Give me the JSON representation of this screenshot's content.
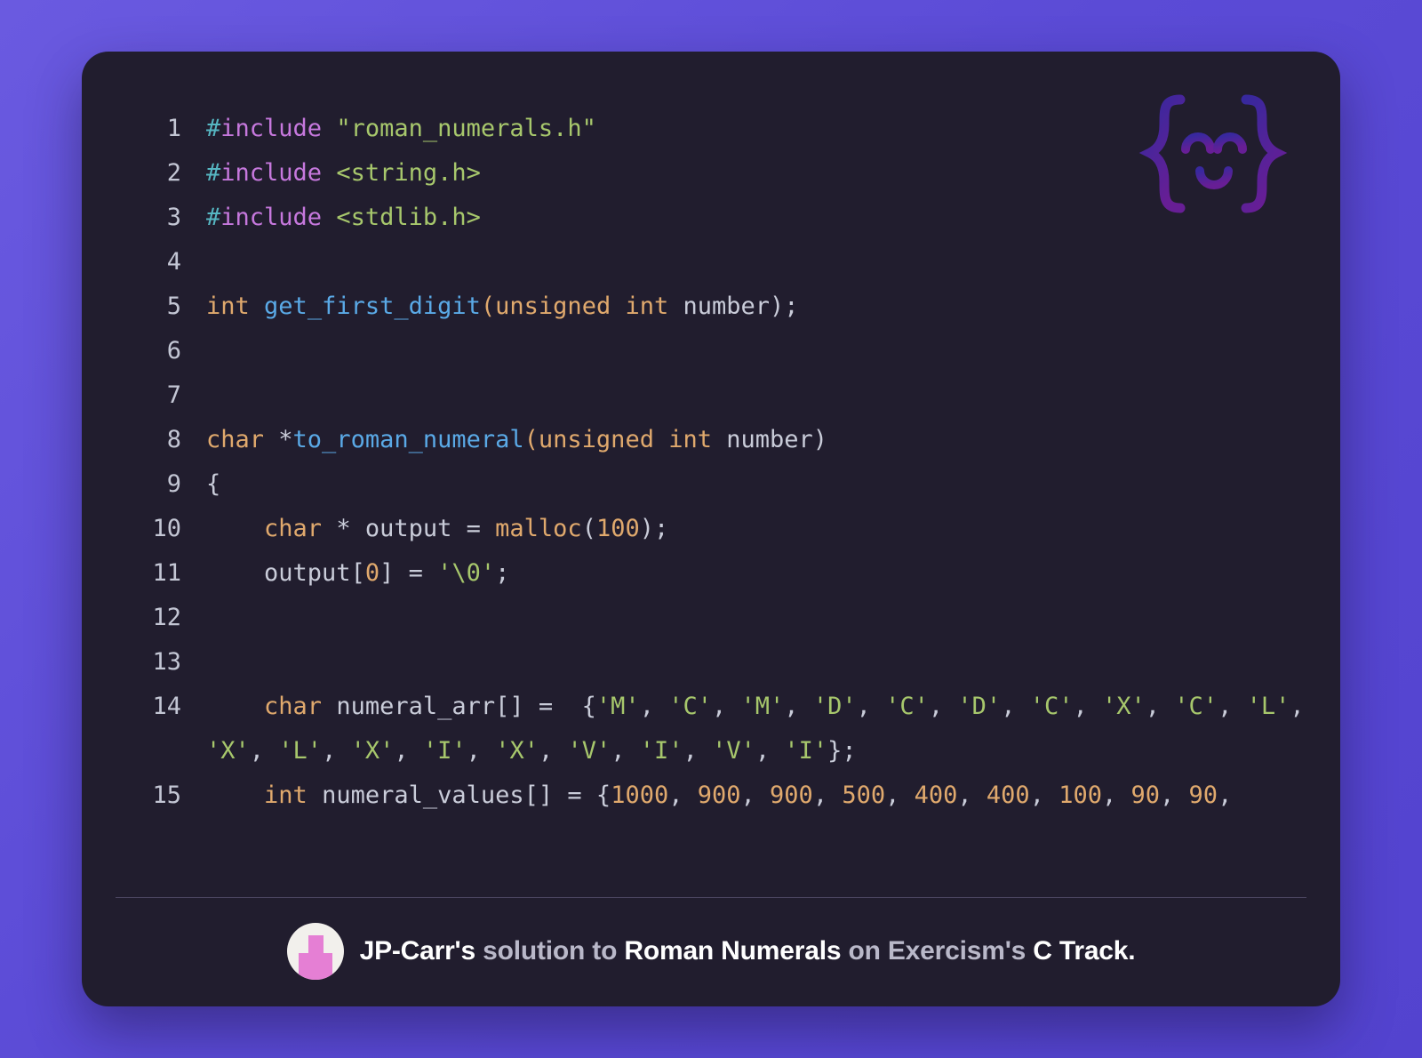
{
  "card": {
    "background_color": "#211d2e",
    "page_background_color": "#5b4bd6"
  },
  "logo": {
    "name": "exercism-logo",
    "colors": [
      "#3b2a9e",
      "#6b1f9e"
    ]
  },
  "editor": {
    "language": "c",
    "line_numbers": [
      "1",
      "2",
      "3",
      "4",
      "5",
      "6",
      "7",
      "8",
      "9",
      "10",
      "11",
      "12",
      "13",
      "14",
      "15"
    ],
    "lines": [
      {
        "number": "1",
        "tokens": [
          {
            "text": "#",
            "type": "pre"
          },
          {
            "text": "include",
            "type": "kw"
          },
          {
            "text": " ",
            "type": "plain"
          },
          {
            "text": "\"roman_numerals.h\"",
            "type": "str"
          }
        ]
      },
      {
        "number": "2",
        "tokens": [
          {
            "text": "#",
            "type": "pre"
          },
          {
            "text": "include",
            "type": "kw"
          },
          {
            "text": " ",
            "type": "plain"
          },
          {
            "text": "<string.h>",
            "type": "str"
          }
        ]
      },
      {
        "number": "3",
        "tokens": [
          {
            "text": "#",
            "type": "pre"
          },
          {
            "text": "include",
            "type": "kw"
          },
          {
            "text": " ",
            "type": "plain"
          },
          {
            "text": "<stdlib.h>",
            "type": "str"
          }
        ]
      },
      {
        "number": "4",
        "tokens": []
      },
      {
        "number": "5",
        "tokens": [
          {
            "text": "int",
            "type": "type"
          },
          {
            "text": " ",
            "type": "plain"
          },
          {
            "text": "get_first_digit",
            "type": "fn"
          },
          {
            "text": "(",
            "type": "type"
          },
          {
            "text": "unsigned",
            "type": "type"
          },
          {
            "text": " ",
            "type": "plain"
          },
          {
            "text": "int",
            "type": "type"
          },
          {
            "text": " number)",
            "type": "plain"
          },
          {
            "text": ";",
            "type": "plain"
          }
        ]
      },
      {
        "number": "6",
        "tokens": []
      },
      {
        "number": "7",
        "tokens": []
      },
      {
        "number": "8",
        "tokens": [
          {
            "text": "char",
            "type": "type"
          },
          {
            "text": " *",
            "type": "plain"
          },
          {
            "text": "to_roman_numeral",
            "type": "fn"
          },
          {
            "text": "(",
            "type": "type"
          },
          {
            "text": "unsigned",
            "type": "type"
          },
          {
            "text": " ",
            "type": "plain"
          },
          {
            "text": "int",
            "type": "type"
          },
          {
            "text": " number)",
            "type": "plain"
          }
        ]
      },
      {
        "number": "9",
        "tokens": [
          {
            "text": "{",
            "type": "plain"
          }
        ]
      },
      {
        "number": "10",
        "tokens": [
          {
            "text": "    ",
            "type": "plain"
          },
          {
            "text": "char",
            "type": "type"
          },
          {
            "text": " * output = ",
            "type": "plain"
          },
          {
            "text": "malloc",
            "type": "type"
          },
          {
            "text": "(",
            "type": "plain"
          },
          {
            "text": "100",
            "type": "num"
          },
          {
            "text": ");",
            "type": "plain"
          }
        ]
      },
      {
        "number": "11",
        "tokens": [
          {
            "text": "    output[",
            "type": "plain"
          },
          {
            "text": "0",
            "type": "num"
          },
          {
            "text": "] = ",
            "type": "plain"
          },
          {
            "text": "'\\0'",
            "type": "str"
          },
          {
            "text": ";",
            "type": "plain"
          }
        ]
      },
      {
        "number": "12",
        "tokens": []
      },
      {
        "number": "13",
        "tokens": []
      },
      {
        "number": "14",
        "tokens": [
          {
            "text": "    ",
            "type": "plain"
          },
          {
            "text": "char",
            "type": "type"
          },
          {
            "text": " numeral_arr[] =  {",
            "type": "plain"
          },
          {
            "text": "'M'",
            "type": "str"
          },
          {
            "text": ", ",
            "type": "plain"
          },
          {
            "text": "'C'",
            "type": "str"
          },
          {
            "text": ", ",
            "type": "plain"
          },
          {
            "text": "'M'",
            "type": "str"
          },
          {
            "text": ", ",
            "type": "plain"
          },
          {
            "text": "'D'",
            "type": "str"
          },
          {
            "text": ", ",
            "type": "plain"
          },
          {
            "text": "'C'",
            "type": "str"
          },
          {
            "text": ", ",
            "type": "plain"
          },
          {
            "text": "'D'",
            "type": "str"
          },
          {
            "text": ", ",
            "type": "plain"
          },
          {
            "text": "'C'",
            "type": "str"
          },
          {
            "text": ", ",
            "type": "plain"
          },
          {
            "text": "'X'",
            "type": "str"
          },
          {
            "text": ", ",
            "type": "plain"
          },
          {
            "text": "'C'",
            "type": "str"
          },
          {
            "text": ", ",
            "type": "plain"
          },
          {
            "text": "'L'",
            "type": "str"
          },
          {
            "text": ", ",
            "type": "plain"
          },
          {
            "text": "'X'",
            "type": "str"
          },
          {
            "text": ", ",
            "type": "plain"
          },
          {
            "text": "'L'",
            "type": "str"
          },
          {
            "text": ", ",
            "type": "plain"
          },
          {
            "text": "'X'",
            "type": "str"
          },
          {
            "text": ", ",
            "type": "plain"
          },
          {
            "text": "'I'",
            "type": "str"
          },
          {
            "text": ", ",
            "type": "plain"
          },
          {
            "text": "'X'",
            "type": "str"
          },
          {
            "text": ", ",
            "type": "plain"
          },
          {
            "text": "'V'",
            "type": "str"
          },
          {
            "text": ", ",
            "type": "plain"
          },
          {
            "text": "'I'",
            "type": "str"
          },
          {
            "text": ", ",
            "type": "plain"
          },
          {
            "text": "'V'",
            "type": "str"
          },
          {
            "text": ", ",
            "type": "plain"
          },
          {
            "text": "'I'",
            "type": "str"
          },
          {
            "text": "};",
            "type": "plain"
          }
        ]
      },
      {
        "number": "15",
        "tokens": [
          {
            "text": "    ",
            "type": "plain"
          },
          {
            "text": "int",
            "type": "type"
          },
          {
            "text": " numeral_values[] = {",
            "type": "plain"
          },
          {
            "text": "1000",
            "type": "num"
          },
          {
            "text": ", ",
            "type": "plain"
          },
          {
            "text": "900",
            "type": "num"
          },
          {
            "text": ", ",
            "type": "plain"
          },
          {
            "text": "900",
            "type": "num"
          },
          {
            "text": ", ",
            "type": "plain"
          },
          {
            "text": "500",
            "type": "num"
          },
          {
            "text": ", ",
            "type": "plain"
          },
          {
            "text": "400",
            "type": "num"
          },
          {
            "text": ", ",
            "type": "plain"
          },
          {
            "text": "400",
            "type": "num"
          },
          {
            "text": ", ",
            "type": "plain"
          },
          {
            "text": "100",
            "type": "num"
          },
          {
            "text": ", ",
            "type": "plain"
          },
          {
            "text": "90",
            "type": "num"
          },
          {
            "text": ", ",
            "type": "plain"
          },
          {
            "text": "90",
            "type": "num"
          },
          {
            "text": ",",
            "type": "plain"
          }
        ]
      }
    ]
  },
  "footer": {
    "avatar_name": "jp-carr-avatar",
    "credit": {
      "user": "JP-Carr's",
      "connector_1": "solution to",
      "exercise": "Roman Numerals",
      "connector_2": "on",
      "site": "Exercism's",
      "track": "C Track."
    }
  }
}
